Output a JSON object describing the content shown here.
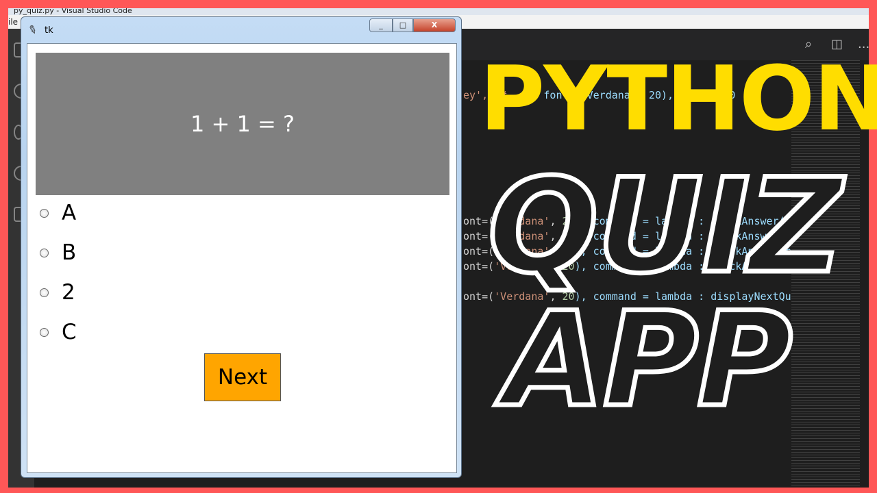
{
  "vscode": {
    "title": "py_quiz.py - Visual Studio Code",
    "menu_first": "ile",
    "toolbar_more": "...",
    "code_lines": [
      {
        "a": "ey',",
        "b": " \"#...\",",
        "c": " font=('Verdana', 20), width=500"
      },
      {
        "a": "ont=(",
        "s": "'Verdana'",
        "n": "20",
        "rest": "), command = lambda : checkAnswer(c"
      },
      {
        "a": "ont=(",
        "s": "'Verdana'",
        "n": "20",
        "rest": "), command = lambda : checkAnswer(c"
      },
      {
        "a": "ont=(",
        "s": "'Verdana'",
        "n": "20",
        "rest": "), command = lambda : checkAnswer(c"
      },
      {
        "a": "ont=(",
        "s": "'Verdana'",
        "n": "20",
        "rest": "), command = lambda : checkAnswer(c"
      },
      {
        "a": "ont=(",
        "s": "'Verdana'",
        "n": "20",
        "rest": "), command = lambda : displayNextQu"
      }
    ]
  },
  "tk_window": {
    "title": "tk",
    "controls": {
      "minimize": "_",
      "maximize": "□",
      "close": "X"
    },
    "question": "1 + 1 = ?",
    "options": [
      "A",
      "B",
      "2",
      "C"
    ],
    "next_label": "Next"
  },
  "overlay": {
    "line1": "PYTHON",
    "line2": "QUIZ",
    "line3": "APP"
  },
  "colors": {
    "border": "#ff5757",
    "title_yellow": "#ffdd00",
    "next_button": "#ffa500",
    "question_bg": "#808080"
  }
}
